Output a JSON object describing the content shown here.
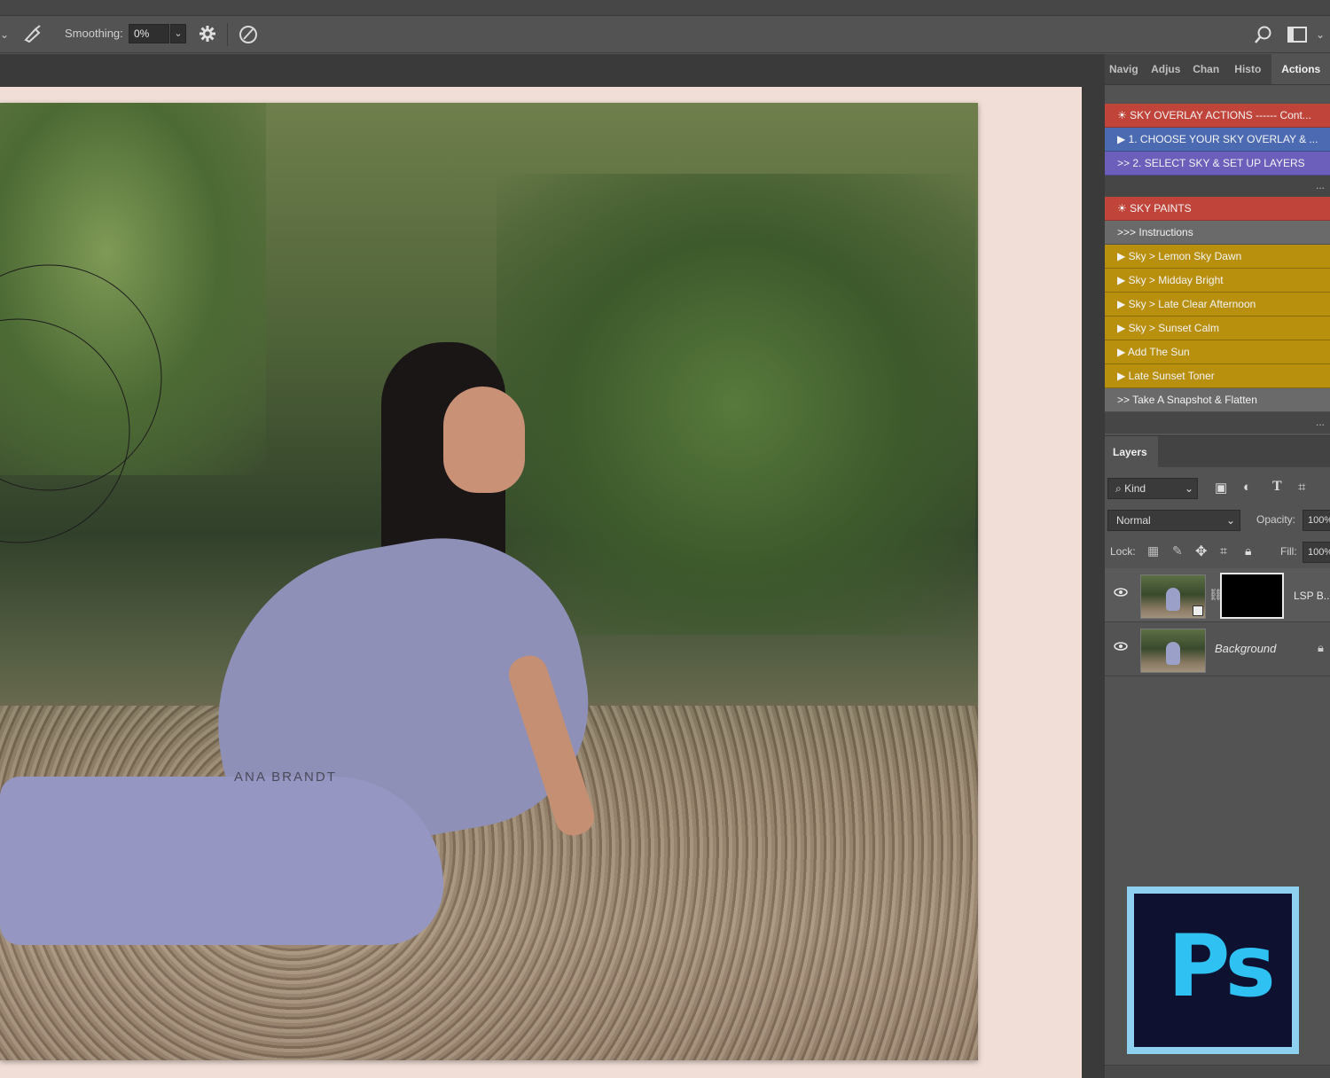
{
  "options_bar": {
    "smoothing_label": "Smoothing:",
    "smoothing_value": "0%"
  },
  "document": {
    "watermark": "ANA BRANDT"
  },
  "panel_tabs": [
    "Navig",
    "Adjus",
    "Chan",
    "Histo",
    "Actions"
  ],
  "actions": {
    "group1": [
      {
        "label": "☀  SKY OVERLAY ACTIONS  ------ Cont...",
        "style": "red"
      },
      {
        "label": "▶   1. CHOOSE YOUR SKY OVERLAY & ...",
        "style": "blue"
      },
      {
        "label": ">> 2. SELECT SKY & SET UP LAYERS",
        "style": "purple"
      }
    ],
    "group2": [
      {
        "label": "☀  SKY PAINTS",
        "style": "red"
      },
      {
        "label": ">>> Instructions",
        "style": "gray"
      },
      {
        "label": "▶    Sky > Lemon Sky Dawn",
        "style": "gold"
      },
      {
        "label": "▶    Sky > Midday Bright",
        "style": "gold"
      },
      {
        "label": "▶    Sky > Late Clear Afternoon",
        "style": "gold"
      },
      {
        "label": "▶    Sky > Sunset Calm",
        "style": "gold"
      },
      {
        "label": "▶   Add The Sun",
        "style": "gold"
      },
      {
        "label": "▶   Late Sunset Toner",
        "style": "gold"
      },
      {
        "label": ">> Take A Snapshot & Flatten",
        "style": "gray"
      }
    ],
    "more_glyph": "..."
  },
  "layers": {
    "tab_label": "Layers",
    "filter_kind": "Kind",
    "blend_mode": "Normal",
    "opacity_label": "Opacity:",
    "opacity_value": "100%",
    "lock_label": "Lock:",
    "fill_label": "Fill:",
    "fill_value": "100%",
    "rows": [
      {
        "name": "LSP B..."
      },
      {
        "name": "Background"
      }
    ]
  },
  "logo": {
    "text": "Ps"
  }
}
